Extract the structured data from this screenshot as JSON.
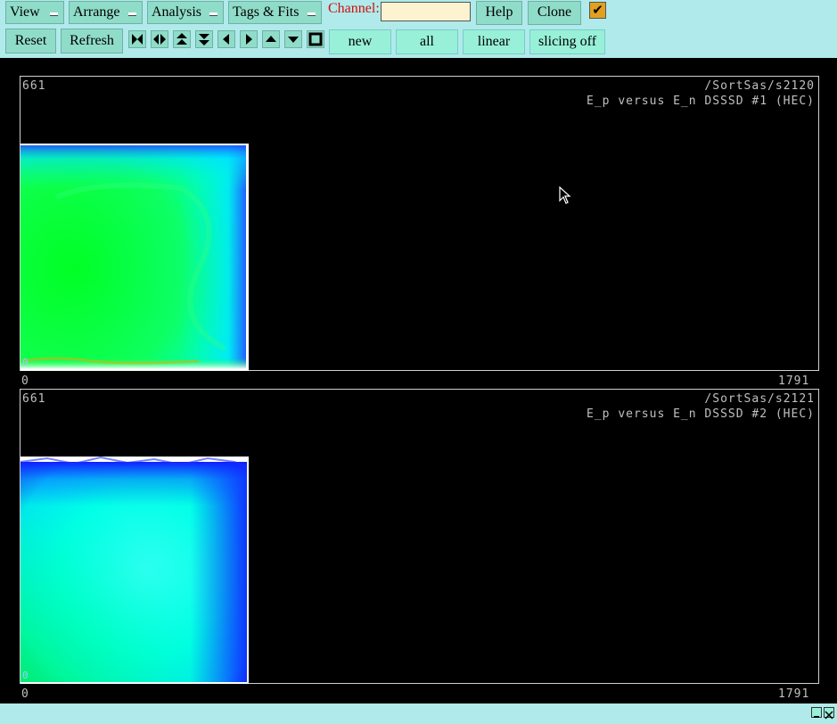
{
  "menus": {
    "view": "View",
    "arrange": "Arrange",
    "analysis": "Analysis",
    "tags_fits": "Tags & Fits"
  },
  "channel": {
    "label": "Channel:",
    "value": ""
  },
  "buttons": {
    "help": "Help",
    "clone": "Clone",
    "reset": "Reset",
    "refresh": "Refresh",
    "new": "new",
    "all": "all",
    "linear": "linear",
    "slicing": "slicing off"
  },
  "checkbox": {
    "checked": true,
    "glyph": "✔"
  },
  "nav_icons": [
    "collapse-horizontal-icon",
    "expand-horizontal-icon",
    "expand-vertical-icon",
    "collapse-vertical-icon",
    "arrow-left-icon",
    "arrow-right-icon",
    "arrow-up-icon",
    "arrow-down-icon",
    "full-range-icon"
  ],
  "panels": [
    {
      "ymax": "661",
      "path": "/SortSas/s2120",
      "title": "E_p versus E_n DSSSD #1 (HEC)",
      "xmin": "0",
      "xmax": "1791",
      "corner": "0"
    },
    {
      "ymax": "661",
      "path": "/SortSas/s2121",
      "title": "E_p versus E_n DSSSD #2 (HEC)",
      "xmin": "0",
      "xmax": "1791",
      "corner": "0"
    }
  ],
  "colors": {
    "toolbar_bg": "#b0eaea",
    "button_bg": "#8fdcc9",
    "channel_label": "#d01010",
    "plot1_main": "#00ff22",
    "plot2_main": "#00ffe0",
    "edge_blue": "#1030ff"
  }
}
